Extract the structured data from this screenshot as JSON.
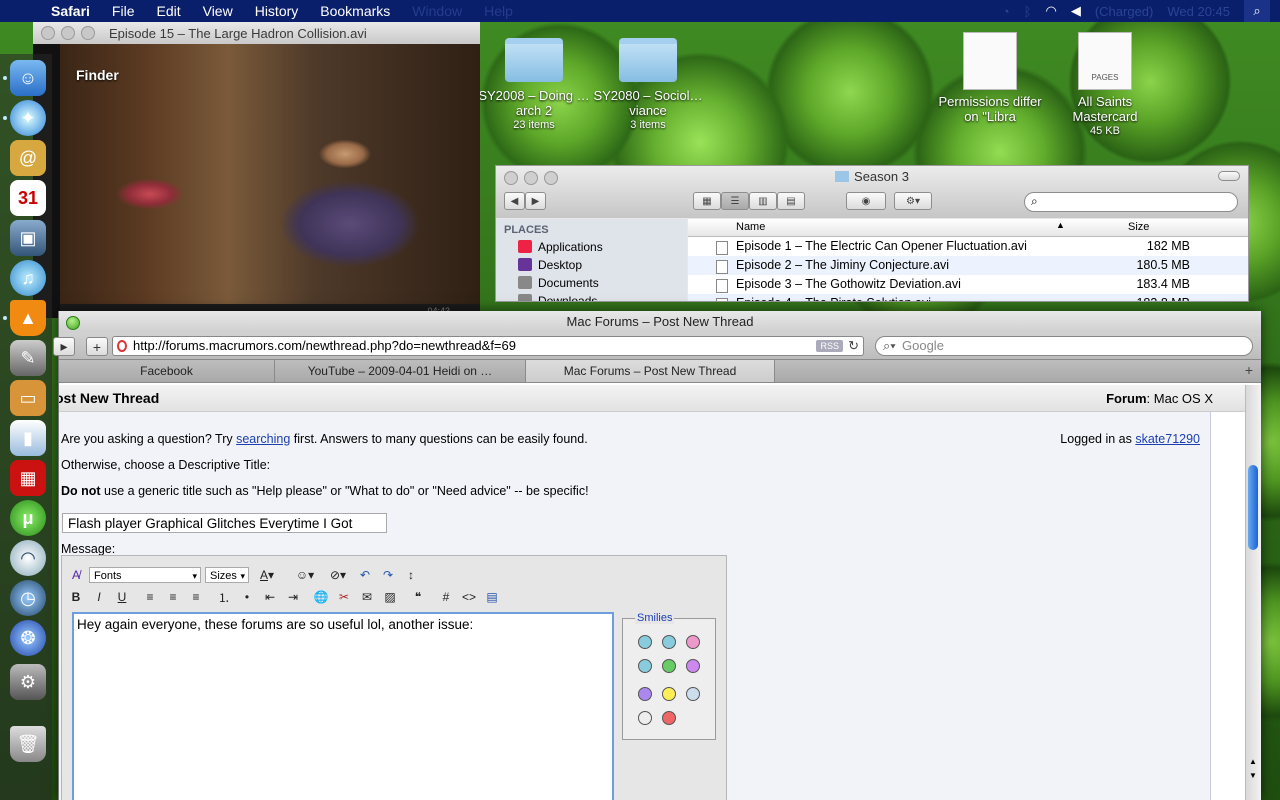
{
  "menubar": {
    "items": [
      "Safari",
      "File",
      "Edit",
      "View",
      "History",
      "Bookmarks",
      "Window",
      "Help"
    ],
    "battery": "(Charged)",
    "clock": "Wed 20:45"
  },
  "finder_label": "Finder",
  "video_window": {
    "title": "Episode 15 – The Large Hadron Collision.avi",
    "time": "04:43"
  },
  "desktop_icons": [
    {
      "name": "SY2008 – Doing …arch 2",
      "sub": "23 items"
    },
    {
      "name": "SY2080 – Sociol…viance",
      "sub": "3 items"
    },
    {
      "name": "Permissions differ on \"Libra",
      "sub": ""
    },
    {
      "name": "All Saints Mastercard",
      "sub": "45 KB",
      "kind": "PAGES"
    }
  ],
  "finder": {
    "title": "Season 3",
    "places_header": "PLACES",
    "places": [
      "Applications",
      "Desktop",
      "Documents",
      "Downloads"
    ],
    "columns": {
      "name": "Name",
      "size": "Size"
    },
    "files": [
      {
        "name": "Episode 1 – The Electric Can Opener Fluctuation.avi",
        "size": "182 MB"
      },
      {
        "name": "Episode 2 – The Jiminy Conjecture.avi",
        "size": "180.5 MB"
      },
      {
        "name": "Episode 3 – The Gothowitz Deviation.avi",
        "size": "183.4 MB"
      },
      {
        "name": "Episode 4 – The Pirate Solution.avi",
        "size": "183.8 MB"
      }
    ]
  },
  "safari": {
    "title": "Mac Forums – Post New Thread",
    "url": "http://forums.macrumors.com/newthread.php?do=newthread&f=69",
    "rss": "RSS",
    "search_placeholder": "Google",
    "tabs": [
      "Facebook",
      "YouTube – 2009-04-01 Heidi on …",
      "Mac Forums – Post New Thread"
    ]
  },
  "page": {
    "heading": "ost New Thread",
    "forum_label": "Forum",
    "forum_value": ": Mac OS X",
    "q_prefix": "Are you asking a question? Try ",
    "q_link": "searching",
    "q_suffix": " first. Answers to many questions can be easily found.",
    "logged_prefix": "Logged in as ",
    "username": "skate71290",
    "choose": "Otherwise, choose a Descriptive Title:",
    "donot_bold": "Do not",
    "donot_rest": " use a generic title such as \"Help please\" or \"What to do\" or \"Need advice\" -- be specific!",
    "title_value": "Flash player Graphical Glitches Everytime I Got",
    "message_label": "Message:",
    "fonts": "Fonts",
    "sizes": "Sizes",
    "message_text": "Hey again everyone, these forums are so useful lol, another issue:",
    "smilies_label": "Smilies"
  }
}
